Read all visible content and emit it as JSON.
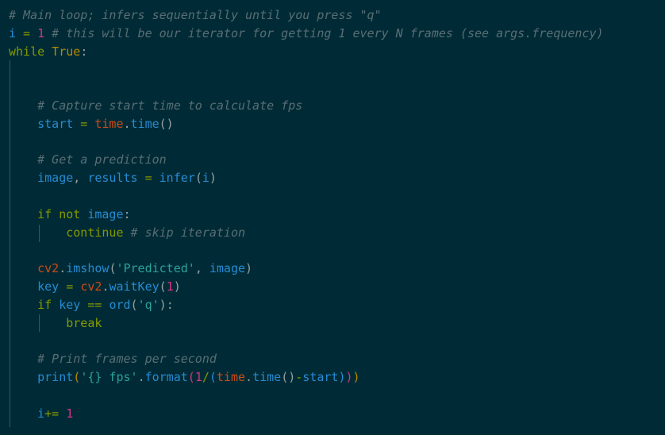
{
  "code": {
    "l1": {
      "comment": "# Main loop; infers sequentially until you press \"q\""
    },
    "l2": {
      "var": "i",
      "op": " = ",
      "num": "1",
      "comment": " # this will be our iterator for getting 1 every N frames (see args.frequency)"
    },
    "l3": {
      "kw": "while",
      "val": " True",
      "colon": ":"
    },
    "l6": {
      "comment": "# Capture start time to calculate fps"
    },
    "l7": {
      "var": "start",
      "op": " = ",
      "mod": "time",
      "dot": ".",
      "fn": "time",
      "paren": "()"
    },
    "l9": {
      "comment": "# Get a prediction"
    },
    "l10": {
      "var1": "image",
      "comma": ", ",
      "var2": "results",
      "op": " = ",
      "fn": "infer",
      "p1": "(",
      "arg": "i",
      "p2": ")"
    },
    "l12": {
      "kw1": "if",
      "kw2": " not",
      "var": " image",
      "colon": ":"
    },
    "l13": {
      "kw": "continue",
      "comment": " # skip iteration"
    },
    "l15": {
      "mod": "cv2",
      "dot": ".",
      "fn": "imshow",
      "p1": "(",
      "str": "'Predicted'",
      "comma": ", ",
      "arg": "image",
      "p2": ")"
    },
    "l16": {
      "var": "key",
      "op": " = ",
      "mod": "cv2",
      "dot": ".",
      "fn": "waitKey",
      "p1": "(",
      "num": "1",
      "p2": ")"
    },
    "l17": {
      "kw": "if",
      "var": " key",
      "op": " == ",
      "fn": "ord",
      "p1": "(",
      "str": "'q'",
      "p2": ")",
      "colon": ":"
    },
    "l18": {
      "kw": "break"
    },
    "l20": {
      "comment": "# Print frames per second"
    },
    "l21": {
      "fn1": "print",
      "p1": "(",
      "str": "'{} fps'",
      "dot": ".",
      "fn2": "format",
      "p2": "(",
      "num": "1",
      "op1": "/",
      "p3": "(",
      "mod": "time",
      "dot2": ".",
      "fn3": "time",
      "p4": "()",
      "op2": "-",
      "var": "start",
      "p5": ")",
      "p6": ")",
      "p7": ")"
    },
    "l23": {
      "var": "i",
      "op": "+= ",
      "num": "1"
    }
  },
  "colors": {
    "background": "#002b36",
    "comment": "#586e75",
    "keyword": "#859900",
    "variable": "#268bd2",
    "number": "#d33682",
    "string": "#2aa198",
    "module": "#cb4b16"
  }
}
